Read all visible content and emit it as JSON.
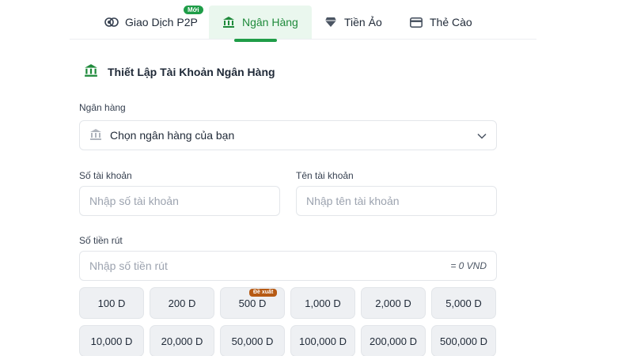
{
  "tabs": [
    {
      "label": "Giao Dịch P2P",
      "icon": "p2p-icon"
    },
    {
      "label": "Ngân Hàng",
      "icon": "bank-icon",
      "active": true
    },
    {
      "label": "Tiền Ảo",
      "icon": "diamond-icon"
    },
    {
      "label": "Thẻ Cào",
      "icon": "card-icon"
    }
  ],
  "badge_new": "Mới",
  "section_title": "Thiết Lập Tài Khoản Ngân Hàng",
  "form": {
    "bank_label": "Ngân hàng",
    "bank_placeholder": "Chọn ngân hàng của bạn",
    "account_number_label": "Số tài khoản",
    "account_number_placeholder": "Nhập số tài khoản",
    "account_name_label": "Tên tài khoản",
    "account_name_placeholder": "Nhập tên tài khoản",
    "amount_label": "Số tiền rút",
    "amount_placeholder": "Nhập số tiền rút",
    "amount_suffix": "= 0 VND"
  },
  "amount_chips": [
    "100 D",
    "200 D",
    "500 D",
    "1,000 D",
    "2,000 D",
    "5,000 D",
    "10,000 D",
    "20,000 D",
    "50,000 D",
    "100,000 D",
    "200,000 D",
    "500,000 D"
  ],
  "suggested_badge": "Đề xuất",
  "colors": {
    "accent": "#1f9d48",
    "active_tab_bg": "#eaf7ee",
    "suggest_badge": "#b65a14"
  }
}
